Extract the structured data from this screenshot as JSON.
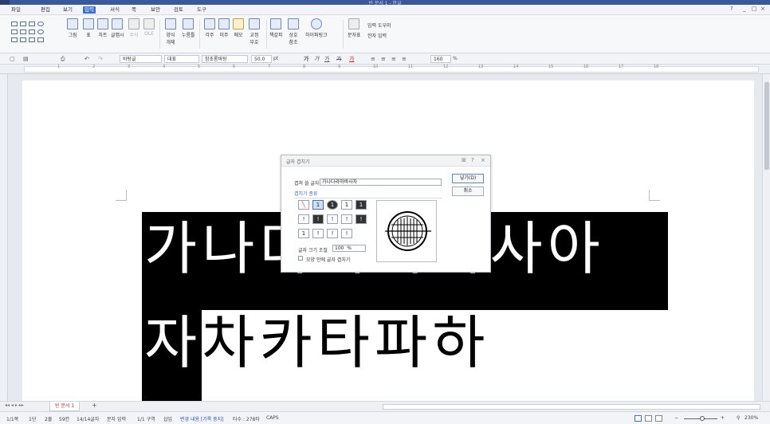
{
  "window": {
    "title": "빈 문서 1 - 한글"
  },
  "menu": {
    "items": [
      "파일",
      "편집",
      "보기",
      "입력",
      "서식",
      "쪽",
      "보안",
      "검토",
      "도구"
    ],
    "active": "입력",
    "right": [
      "?",
      "_",
      "□",
      "×"
    ]
  },
  "ribbon": {
    "buttons": [
      "그림",
      "표",
      "차트",
      "글맵시",
      "수식",
      "OLE",
      "양식 개체",
      "누름틀",
      "각주",
      "미주",
      "메모",
      "교정 부호",
      "책갈피",
      "상호 참조",
      "하이퍼링크",
      "문자표",
      "입력 도우미",
      "한자 입력"
    ]
  },
  "format_bar": {
    "style": "바탕글",
    "lang": "대표",
    "font": "함초롬바탕",
    "size": "50.0",
    "size_unit": "pt",
    "bold": "가",
    "italic": "가",
    "underline": "가",
    "strike": "가",
    "color": "가",
    "zoom": "160",
    "zoom_unit": "%"
  },
  "ruler": {
    "numbers": [
      "1",
      "2",
      "3",
      "4",
      "5",
      "6",
      "7",
      "8",
      "9",
      "10",
      "11",
      "12",
      "13",
      "14",
      "15",
      "16",
      "17",
      "18"
    ]
  },
  "document": {
    "line1": "가나다라마바사아",
    "line2_white": "자",
    "line2_black": "차카타파하"
  },
  "dialog": {
    "title": "글자 겹치기",
    "text_label": "겹쳐 쓸 글자",
    "text_value": "가나다라마바사자",
    "section": "겹치기 종류",
    "size_label": "글자 크기 조절",
    "size_value": "100",
    "size_unit": "%",
    "checkbox_label": "모양 안에 글자 겹치기",
    "ok": "넣기(D)",
    "cancel": "취소",
    "enclosures": [
      "",
      "1",
      "1",
      "1",
      "1",
      "!",
      "!",
      "!",
      "!",
      "!",
      "1",
      "!",
      "!",
      "!"
    ]
  },
  "tabs": {
    "doc_tab": "빈 문서 1",
    "add": "+"
  },
  "status": {
    "page": "1/1쪽",
    "column": "1단",
    "line": "2줄",
    "col": "59칸",
    "chars": "14/14글자",
    "input": "문자 입력",
    "section": "1/1 구역",
    "insert": "삽입",
    "track": "변경 내용 [기록 중지]",
    "typing": "타수 : 278타",
    "caps": "CAPS",
    "zoom": "230%"
  },
  "colors": {
    "accent": "#3b6fcf",
    "titlebar": "#3b5998",
    "selection": "#000000"
  }
}
